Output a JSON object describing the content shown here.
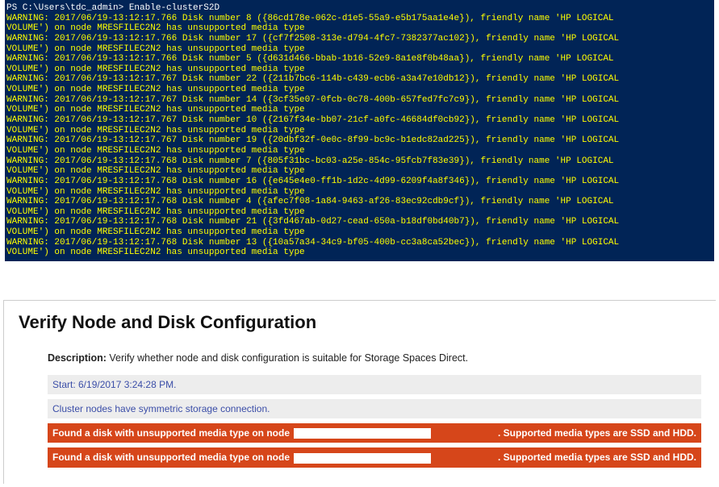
{
  "console": {
    "prompt": "PS C:\\Users\\tdc_admin> ",
    "command": "Enable-clusterS2D",
    "warnings": [
      {
        "ts": "2017/06/19-13:12:17.766",
        "num": "8",
        "guid": "{86cd178e-062c-d1e5-55a9-e5b175aa1e4e}"
      },
      {
        "ts": "2017/06/19-13:12:17.766",
        "num": "17",
        "guid": "{cf7f2508-313e-d794-4fc7-7382377ac102}"
      },
      {
        "ts": "2017/06/19-13:12:17.766",
        "num": "5",
        "guid": "{d631d466-bbab-1b16-52e9-8a1e8f0b48aa}"
      },
      {
        "ts": "2017/06/19-13:12:17.767",
        "num": "22",
        "guid": "{211b7bc6-114b-c439-ecb6-a3a47e10db12}"
      },
      {
        "ts": "2017/06/19-13:12:17.767",
        "num": "14",
        "guid": "{3cf35e07-0fcb-0c78-400b-657fed7fc7c9}"
      },
      {
        "ts": "2017/06/19-13:12:17.767",
        "num": "10",
        "guid": "{2167f34e-bb07-21cf-a0fc-46684df0cb92}"
      },
      {
        "ts": "2017/06/19-13:12:17.767",
        "num": "19",
        "guid": "{20dbf32f-0e0c-8f99-bc9c-b1edc82ad225}"
      },
      {
        "ts": "2017/06/19-13:12:17.768",
        "num": "7",
        "guid": "{805f31bc-bc03-a25e-854c-95fcb7f83e39}"
      },
      {
        "ts": "2017/06/19-13:12:17.768",
        "num": "16",
        "guid": "{e645e4e0-ff1b-1d2c-4d99-6209f4a8f346}"
      },
      {
        "ts": "2017/06/19-13:12:17.768",
        "num": "4",
        "guid": "{afec7f08-1a84-9463-af26-83ec92cdb9cf}"
      },
      {
        "ts": "2017/06/19-13:12:17.768",
        "num": "21",
        "guid": "{3fd467ab-0d27-cead-650a-b18df0bd40b7}"
      },
      {
        "ts": "2017/06/19-13:12:17.768",
        "num": "13",
        "guid": "{10a57a34-34c9-bf05-400b-cc3a8ca52bec}"
      }
    ],
    "friendly_name": "HP LOGICAL\nVOLUME",
    "node": "MRESFILEC2N2",
    "warning_tail": "has unsupported media type"
  },
  "report": {
    "title": "Verify Node and Disk Configuration",
    "desc_label": "Description:",
    "desc_text": " Verify whether node and disk configuration is suitable for Storage Spaces Direct.",
    "start": "Start: 6/19/2017 3:24:28 PM.",
    "symmetric": "Cluster nodes have symmetric storage connection.",
    "error_left": "Found a disk with unsupported media type on node",
    "error_right": ". Supported media types are SSD and HDD."
  }
}
